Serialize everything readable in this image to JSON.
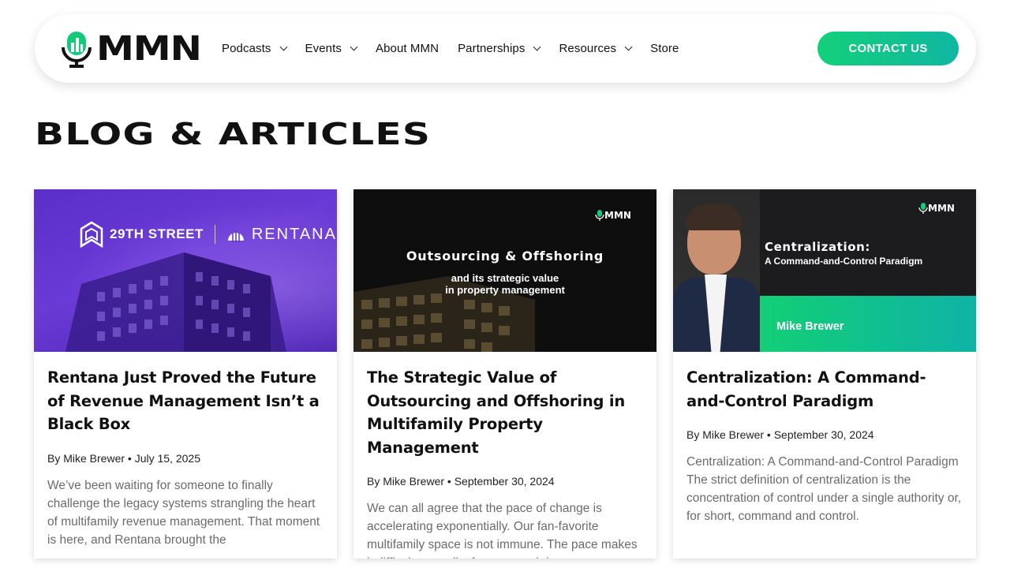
{
  "header": {
    "logo_text": "MMN",
    "menu": [
      {
        "label": "Podcasts",
        "has_dropdown": true
      },
      {
        "label": "Events",
        "has_dropdown": true
      },
      {
        "label": "About MMN",
        "has_dropdown": false
      },
      {
        "label": "Partnerships",
        "has_dropdown": true
      },
      {
        "label": "Resources",
        "has_dropdown": true
      },
      {
        "label": "Store",
        "has_dropdown": false
      }
    ],
    "contact_label": "CONTACT US"
  },
  "page": {
    "title": "BLOG & ARTICLES"
  },
  "cards": [
    {
      "image": {
        "brand_left": "29TH STREET",
        "brand_right": "RENTANA"
      },
      "title": "Rentana Just Proved the Future of Revenue Management Isn’t a Black Box",
      "meta": "By Mike Brewer • July 15, 2025",
      "excerpt": "We’ve been waiting for someone to finally challenge the legacy systems strangling the heart of multifamily revenue management. That moment is here, and Rentana brought the"
    },
    {
      "image": {
        "logo": "MMN",
        "headline": "Outsourcing & Offshoring",
        "subline_1": "and its strategic value",
        "subline_2": "in property management"
      },
      "title": "The Strategic Value of Outsourcing and Offshoring in Multifamily Property Management",
      "meta": "By Mike Brewer • September 30, 2024",
      "excerpt": "We can all agree that the pace of change is accelerating exponentially. Our fan-favorite multifamily space is not immune. The pace makes it difficult to predict future growth by"
    },
    {
      "image": {
        "logo": "MMN",
        "headline": "Centralization:",
        "subline": "A Command-and-Control Paradigm",
        "person": "Mike Brewer"
      },
      "title": "Centralization: A Command-and-Control Paradigm",
      "meta": "By Mike Brewer • September 30, 2024",
      "excerpt": "Centralization: A Command-and-Control Paradigm The strict definition of centralization is the concentration of control under a single authority or, for short, command and control."
    }
  ],
  "colors": {
    "accent_green": "#13d07a",
    "accent_teal": "#10b6a2",
    "rentana_purple": "#5a2fc9"
  }
}
